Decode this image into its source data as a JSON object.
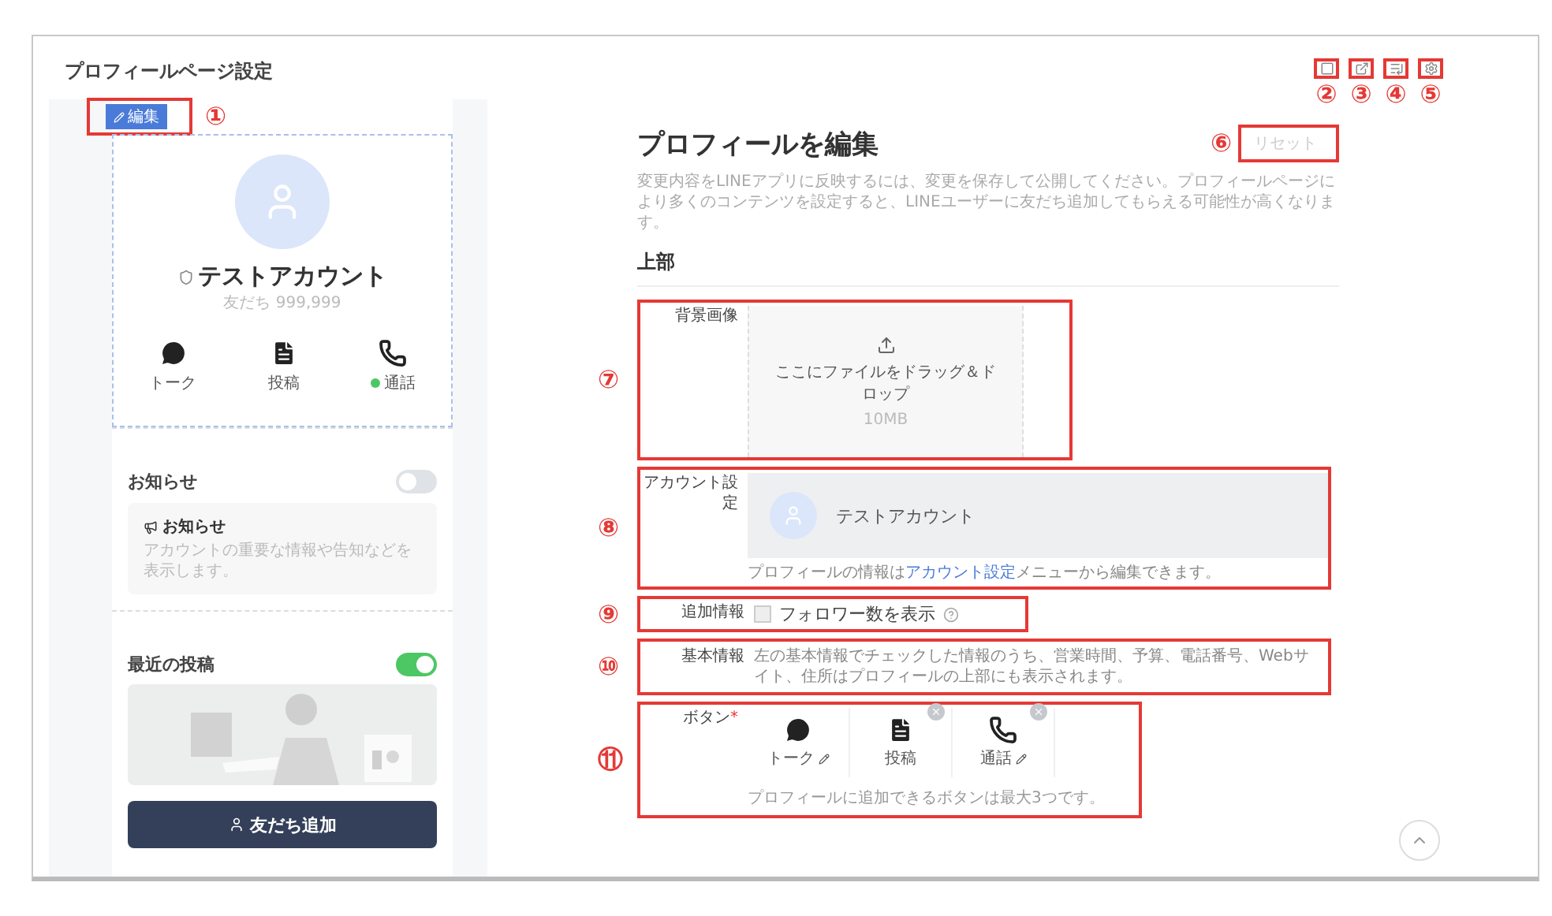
{
  "page_title": "プロフィールページ設定",
  "toolbar": [
    {
      "kind": "preview",
      "callout": "②"
    },
    {
      "kind": "share",
      "callout": "③"
    },
    {
      "kind": "list",
      "callout": "④"
    },
    {
      "kind": "settings",
      "callout": "⑤"
    }
  ],
  "preview": {
    "edit_badge": {
      "label": "編集",
      "callout": "①"
    },
    "account_name": "テストアカウント",
    "friends": "友だち 999,999",
    "actions": [
      {
        "kind": "chat",
        "label": "トーク",
        "online": false
      },
      {
        "kind": "post",
        "label": "投稿",
        "online": false
      },
      {
        "kind": "call",
        "label": "通話",
        "online": true
      }
    ],
    "notice": {
      "title": "お知らせ",
      "on": false,
      "card_title": "お知らせ",
      "card_text": "アカウントの重要な情報や告知などを表示します。"
    },
    "recent_posts": {
      "title": "最近の投稿",
      "on": true
    },
    "add_friend": "友だち追加"
  },
  "editor": {
    "title": "プロフィールを編集",
    "reset": {
      "label": "リセット",
      "callout": "⑥",
      "disabled": true
    },
    "description": "変更内容をLINEアプリに反映するには、変更を保存して公開してください。プロフィールページにより多くのコンテンツを設定すると、LINEユーザーに友だち追加してもらえる可能性が高くなります。",
    "section": "上部",
    "rows": [
      {
        "kind": "upload",
        "callout": "⑦",
        "label": "背景画像",
        "text": "ここにファイルをドラッグ＆ドロップ",
        "limit": "10MB"
      },
      {
        "kind": "account",
        "callout": "⑧",
        "label": "アカウント設定",
        "name": "テストアカウント",
        "note_before": "プロフィールの情報は",
        "note_link": "アカウント設定",
        "note_after": "メニューから編集できます。"
      },
      {
        "kind": "checkbox",
        "callout": "⑨",
        "label": "追加情報",
        "text": "フォロワー数を表示",
        "checked": false
      },
      {
        "kind": "text",
        "callout": "⑩",
        "label": "基本情報",
        "text": "左の基本情報でチェックした情報のうち、営業時間、予算、電話番号、Webサイト、住所はプロフィールの上部にも表示されます。"
      },
      {
        "kind": "buttons",
        "callout": "⑪",
        "label": "ボタン",
        "required_mark": "*",
        "items": [
          {
            "kind": "chat",
            "label": "トーク",
            "editable": true,
            "removable": false
          },
          {
            "kind": "post",
            "label": "投稿",
            "editable": false,
            "removable": true
          },
          {
            "kind": "call",
            "label": "通話",
            "editable": true,
            "removable": true
          }
        ],
        "note": "プロフィールに追加できるボタンは最大3つです。"
      }
    ]
  }
}
